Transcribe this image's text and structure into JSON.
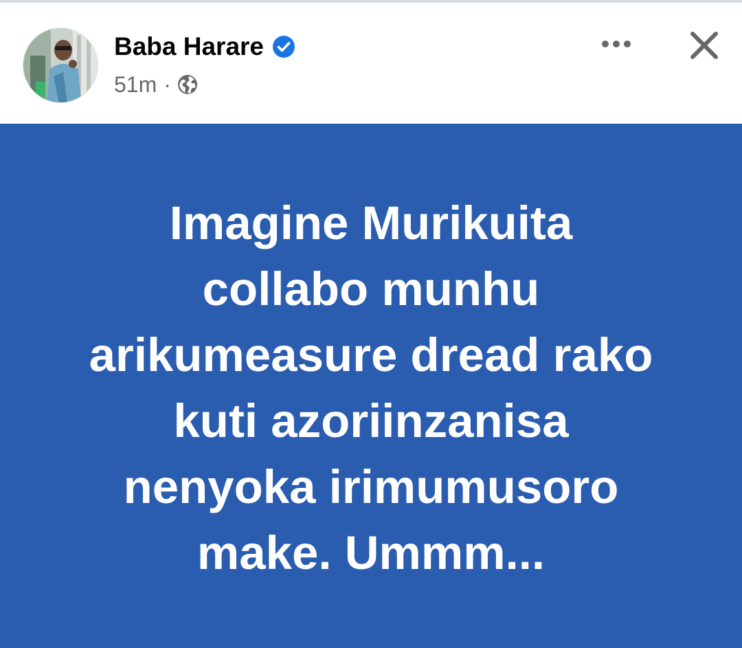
{
  "post": {
    "author_name": "Baba Harare",
    "verified": true,
    "timestamp": "51m",
    "separator": "·",
    "audience_icon": "globe-icon",
    "avatar_icon": "profile-photo",
    "more_icon": "more-options-icon",
    "close_icon": "close-icon",
    "background_color": "#2a5cb0",
    "text_color": "#ffffff",
    "text_lines": [
      "Imagine Murikuita",
      "collabo munhu",
      "arikumeasure dread rako",
      "kuti azoriinzanisa",
      "nenyoka irimumusoro",
      "make. Ummm..."
    ]
  },
  "colors": {
    "verified_badge": "#1b74e4",
    "secondary_text": "#65676b",
    "primary_text": "#050505"
  }
}
